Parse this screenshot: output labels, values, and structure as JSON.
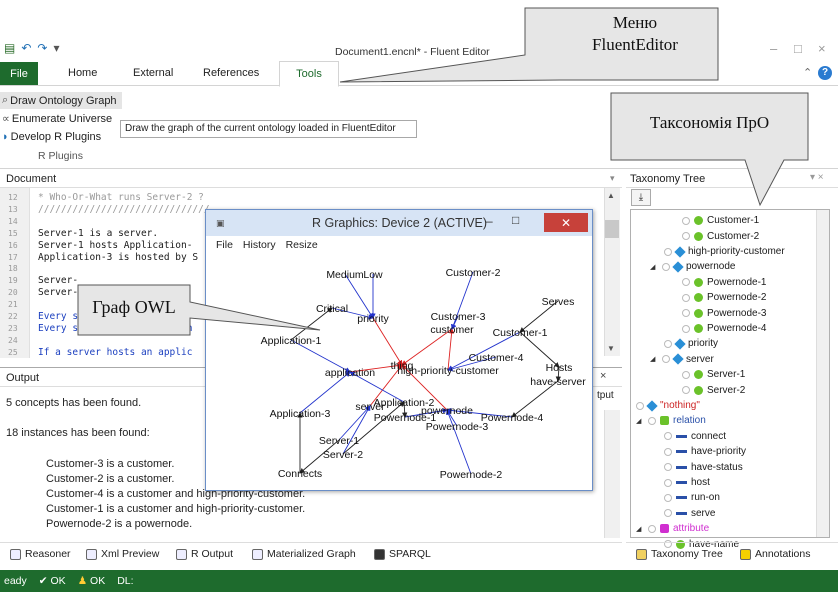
{
  "window": {
    "title": "Document1.encnl* - Fluent Editor",
    "minimize": "–",
    "maximize": "□",
    "close": "×"
  },
  "ribbon": {
    "tabs": [
      "File",
      "Home",
      "External",
      "References",
      "Tools"
    ],
    "active_tab": "Tools",
    "items": [
      "Draw Ontology Graph",
      "Enumerate Universe",
      "Develop R Plugins"
    ],
    "group_label": "R Plugins",
    "tooltip": "Draw the graph of the current ontology loaded in FluentEditor",
    "help": "?"
  },
  "document": {
    "header": "Document",
    "line_numbers": [
      "12",
      "13",
      "14",
      "15",
      "16",
      "17",
      "18",
      "19",
      "20",
      "21",
      "22",
      "23",
      "24",
      "25"
    ],
    "lines": [
      {
        "text": "* Who-Or-What runs Server-2 ?",
        "style": "grey"
      },
      {
        "text": "//////////////////////////////",
        "style": "grey"
      },
      {
        "text": "",
        "style": "black"
      },
      {
        "text": "Server-1 is a server.",
        "style": "black"
      },
      {
        "text": "Server-1 hosts Application-",
        "style": "black"
      },
      {
        "text": "Application-3 is hosted by S",
        "style": "black"
      },
      {
        "text": "",
        "style": "black"
      },
      {
        "text": "Server-",
        "style": "black"
      },
      {
        "text": "Server-",
        "style": "black"
      },
      {
        "text": "",
        "style": "black"
      },
      {
        "text": "Every s",
        "style": "blue"
      },
      {
        "text": "Every server must have both",
        "style": "blue"
      },
      {
        "text": "",
        "style": "black"
      },
      {
        "text": "If a server hosts an applic",
        "style": "blue"
      }
    ]
  },
  "output": {
    "header": "Output",
    "side_label": "tput",
    "close": "×",
    "lines": [
      "5 concepts has been found.",
      "18 instances has been found:",
      "Customer-3 is a customer.",
      "Customer-2 is a customer.",
      "Customer-4 is a customer and high-priority-customer.",
      "Customer-1 is a customer and high-priority-customer.",
      "Powernode-2 is a powernode."
    ]
  },
  "bottom_tabs": [
    "Reasoner",
    "Xml Preview",
    "R Output",
    "Materialized Graph",
    "SPARQL"
  ],
  "taxonomy": {
    "header": "Taxonomy Tree",
    "export": "⤓",
    "bottom_tabs": [
      "Taxonomy Tree",
      "Annotations"
    ],
    "nodes": [
      {
        "label": "Customer-1",
        "kind": "instance",
        "level": 3
      },
      {
        "label": "Customer-2",
        "kind": "instance",
        "level": 3
      },
      {
        "label": "high-priority-customer",
        "kind": "concept",
        "level": 2
      },
      {
        "label": "powernode",
        "kind": "concept",
        "level": 1
      },
      {
        "label": "Powernode-1",
        "kind": "instance",
        "level": 3
      },
      {
        "label": "Powernode-2",
        "kind": "instance",
        "level": 3
      },
      {
        "label": "Powernode-3",
        "kind": "instance",
        "level": 3
      },
      {
        "label": "Powernode-4",
        "kind": "instance",
        "level": 3
      },
      {
        "label": "priority",
        "kind": "concept",
        "level": 2
      },
      {
        "label": "server",
        "kind": "concept",
        "level": 1
      },
      {
        "label": "Server-1",
        "kind": "instance",
        "level": 3
      },
      {
        "label": "Server-2",
        "kind": "instance",
        "level": 3
      },
      {
        "label": "\"nothing\"",
        "kind": "nothing",
        "level": 0
      },
      {
        "label": "relation",
        "kind": "relation-root",
        "level": 0
      },
      {
        "label": "connect",
        "kind": "relation",
        "level": 2
      },
      {
        "label": "have-priority",
        "kind": "relation",
        "level": 2
      },
      {
        "label": "have-status",
        "kind": "relation",
        "level": 2
      },
      {
        "label": "host",
        "kind": "relation",
        "level": 2
      },
      {
        "label": "run-on",
        "kind": "relation",
        "level": 2
      },
      {
        "label": "serve",
        "kind": "relation",
        "level": 2
      },
      {
        "label": "attribute",
        "kind": "attribute-root",
        "level": 0
      },
      {
        "label": "have-name",
        "kind": "attribute",
        "level": 2
      }
    ]
  },
  "status": {
    "ready": "eady",
    "ok1": "OK",
    "ok2": "OK",
    "dl": "DL:"
  },
  "rgraphics": {
    "title": "R Graphics: Device 2 (ACTIVE)",
    "menu": [
      "File",
      "History",
      "Resize"
    ],
    "nodes": [
      "Medium",
      "Low",
      "Customer-2",
      "Critical",
      "priority",
      "Serves",
      "Customer-3",
      "customer",
      "Customer-1",
      "Application-1",
      "thing",
      "Customer-4",
      "high-priority-customer",
      "Hosts",
      "application",
      "have-server",
      "Application-2",
      "server",
      "powernode",
      "Powernode-1",
      "Powernode-4",
      "Application-3",
      "Powernode-3",
      "Server-1",
      "Server-2",
      "Connects",
      "Powernode-2"
    ]
  },
  "callouts": {
    "menu": "Меню\nFluentEditor",
    "menu_line1": "Меню",
    "menu_line2": "FluentEditor",
    "taxonomy": "Таксономія ПрО",
    "graph": "Граф OWL"
  },
  "colors": {
    "accent_green": "#1e6b2d",
    "instance_green": "#6bc22a",
    "concept_blue": "#2a8fd6",
    "relation_blue": "#2a50a8",
    "attribute_magenta": "#d02fd0",
    "nothing_red": "#cc2222"
  }
}
